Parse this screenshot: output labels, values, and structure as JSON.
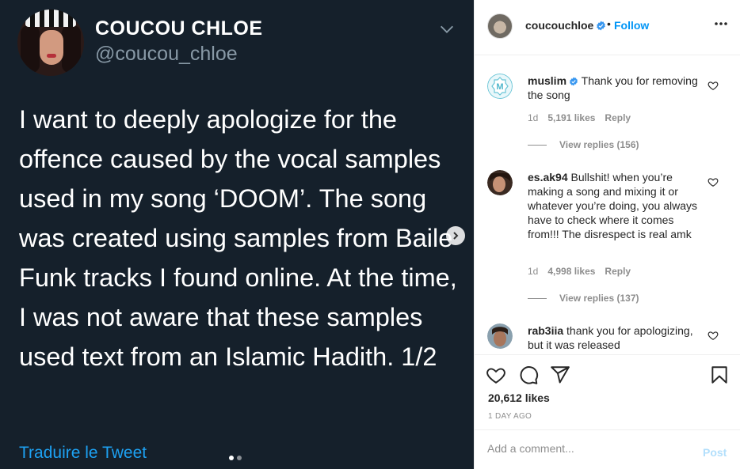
{
  "tweet": {
    "name": "COUCOU CHLOE",
    "handle": "@coucou_chloe",
    "body": "I want to deeply apologize for the offence caused by the vocal samples used in my song ‘DOOM’. The song was created using samples from Baile Funk tracks I found online. At the time, I was not aware that these samples used text from an Islamic Hadith. 1/2",
    "translate": "Traduire le Tweet",
    "bg_color": "#15202b",
    "link_color": "#1da1f2",
    "carousel_dots": 2,
    "carousel_active": 1
  },
  "post": {
    "username": "coucouchloe",
    "follow_sep": "•",
    "follow": "Follow",
    "likes": "20,612 likes",
    "date": "1 DAY AGO",
    "add_comment_placeholder": "Add a comment...",
    "post_label": "Post"
  },
  "comments": [
    {
      "user": "muslim",
      "verified": true,
      "text": "Thank you for removing the song",
      "time": "1d",
      "likes": "5,191 likes",
      "reply": "Reply",
      "view_replies": "View replies (156)"
    },
    {
      "user": "es.ak94",
      "verified": false,
      "text": "Bullshit! when you’re making a song and mixing it or whatever you’re doing, you always have to check where it comes from!!! The disrespect is real amk",
      "time": "1d",
      "likes": "4,998 likes",
      "reply": "Reply",
      "view_replies": "View replies (137)"
    },
    {
      "user": "rab3iia",
      "verified": false,
      "text": "thank you for apologizing, but it was released",
      "time": "",
      "likes": "",
      "reply": "",
      "view_replies": ""
    }
  ],
  "icons": {
    "tweet_menu": "chevron-down-icon",
    "carousel": "chevron-right-icon",
    "more": "more-horizontal-icon",
    "verified": "verified-badge-icon",
    "like": "heart-icon",
    "comment": "comment-icon",
    "share": "send-icon",
    "save": "bookmark-icon"
  },
  "colors": {
    "ig_blue": "#0095f6",
    "ig_text": "#262626",
    "ig_muted": "#8e8e8e",
    "post_disabled": "#b2dffc"
  }
}
